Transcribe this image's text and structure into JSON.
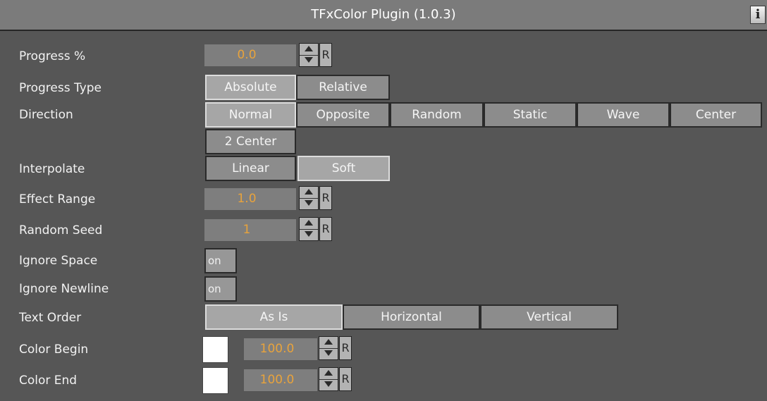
{
  "title": "TFxColor Plugin (1.0.3)",
  "info_label": "i",
  "rows": {
    "progress": {
      "label": "Progress %",
      "value": "0.0",
      "reset": "R"
    },
    "progress_type": {
      "label": "Progress Type",
      "options": [
        "Absolute",
        "Relative"
      ],
      "selected": "Absolute"
    },
    "direction": {
      "label": "Direction",
      "options": [
        "Normal",
        "Opposite",
        "Random",
        "Static",
        "Wave",
        "Center",
        "2 Center"
      ],
      "selected": "Normal"
    },
    "interpolate": {
      "label": "Interpolate",
      "options": [
        "Linear",
        "Soft"
      ],
      "selected": "Linear"
    },
    "effect_range": {
      "label": "Effect Range",
      "value": "1.0",
      "reset": "R"
    },
    "random_seed": {
      "label": "Random Seed",
      "value": "1",
      "reset": "R"
    },
    "ignore_space": {
      "label": "Ignore Space",
      "toggle": "on"
    },
    "ignore_newline": {
      "label": "Ignore Newline",
      "toggle": "on"
    },
    "text_order": {
      "label": "Text Order",
      "options": [
        "As Is",
        "Horizontal",
        "Vertical"
      ],
      "selected": "As Is"
    },
    "color_begin": {
      "label": "Color Begin",
      "color": "#ffffff",
      "value": "100.0",
      "reset": "R"
    },
    "color_end": {
      "label": "Color End",
      "color": "#ffffff",
      "value": "100.0",
      "reset": "R"
    }
  },
  "colors": {
    "panel_bg": "#565656",
    "title_bg": "#7b7b7b",
    "value_text": "#e8a33c"
  }
}
